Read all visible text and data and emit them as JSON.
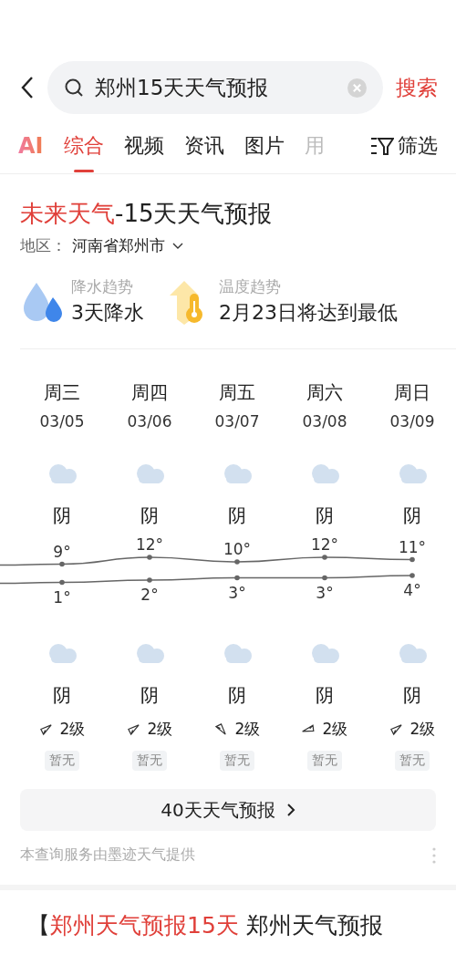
{
  "search": {
    "query": "郑州15天天气预报",
    "submit": "搜索"
  },
  "tabs": [
    {
      "label": "AI",
      "kind": "logo",
      "selected": false
    },
    {
      "label": "综合",
      "kind": "text",
      "selected": true
    },
    {
      "label": "视频",
      "kind": "text",
      "selected": false
    },
    {
      "label": "资讯",
      "kind": "text",
      "selected": false
    },
    {
      "label": "图片",
      "kind": "text",
      "selected": false
    },
    {
      "label": "用",
      "kind": "text",
      "selected": false
    }
  ],
  "filter": "筛选",
  "card": {
    "title_highlight": "未来天气",
    "title_rest": "-15天天气预报",
    "region_label": "地区：",
    "region": "河南省郑州市",
    "trends": [
      {
        "kind": "rain",
        "label": "降水趋势",
        "value": "3天降水"
      },
      {
        "kind": "temperature",
        "label": "温度趋势",
        "value": "2月23日将达到最低"
      }
    ],
    "days": [
      {
        "weekday": "周三",
        "date": "03/05",
        "day_weather": "阴",
        "high": "9°",
        "low": "1°",
        "night_weather": "阴",
        "kind": "southwest",
        "wind": "2级",
        "air": "暂无"
      },
      {
        "weekday": "周四",
        "date": "03/06",
        "day_weather": "阴",
        "high": "12°",
        "low": "2°",
        "night_weather": "阴",
        "kind": "southwest",
        "wind": "2级",
        "air": "暂无"
      },
      {
        "weekday": "周五",
        "date": "03/07",
        "day_weather": "阴",
        "high": "10°",
        "low": "3°",
        "night_weather": "阴",
        "kind": "northwest",
        "wind": "2级",
        "air": "暂无"
      },
      {
        "weekday": "周六",
        "date": "03/08",
        "day_weather": "阴",
        "high": "12°",
        "low": "3°",
        "night_weather": "阴",
        "kind": "east",
        "wind": "2级",
        "air": "暂无"
      },
      {
        "weekday": "周日",
        "date": "03/09",
        "day_weather": "阴",
        "high": "11°",
        "low": "4°",
        "night_weather": "阴",
        "kind": "southwest",
        "wind": "2级",
        "air": "暂无"
      }
    ],
    "more_button": "40天天气预报",
    "source": "本查询服务由墨迹天气提供"
  },
  "next_result": {
    "prefix": "【",
    "highlight": "郑州天气预报15天",
    "rest": " 郑州天气预报"
  }
}
